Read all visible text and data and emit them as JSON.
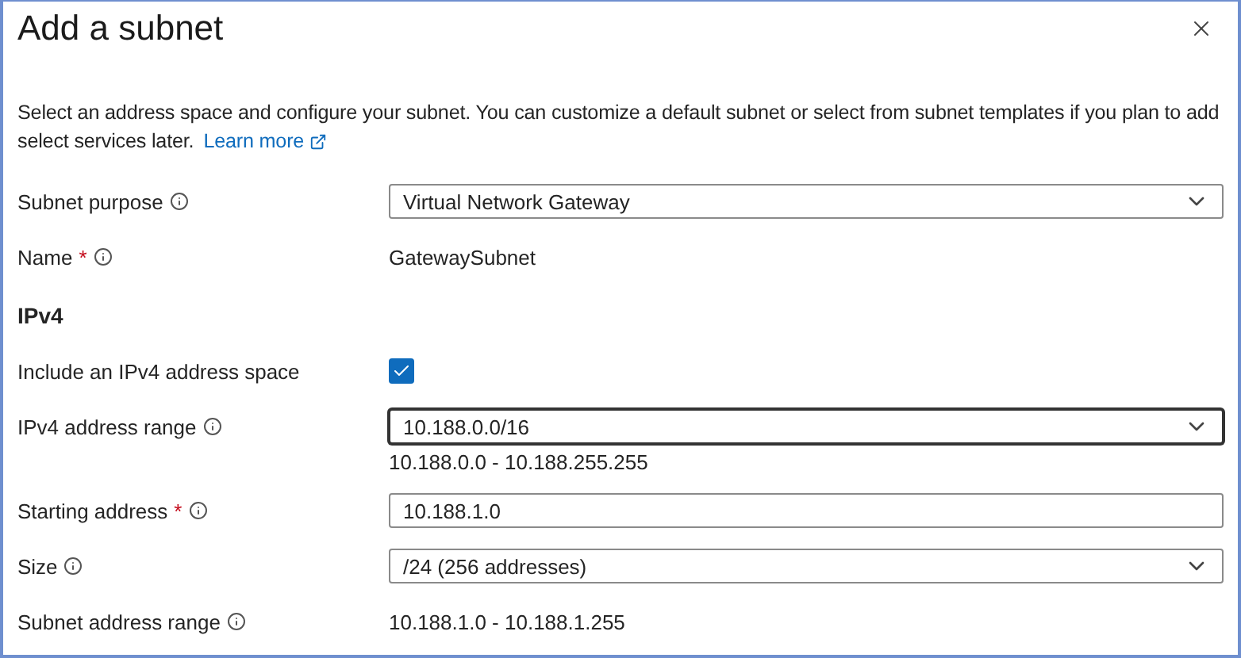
{
  "dialog": {
    "title": "Add a subnet",
    "description": "Select an address space and configure your subnet. You can customize a default subnet or select from subnet templates if you plan to add select services later.",
    "learn_more": "Learn more"
  },
  "fields": [
    {
      "kind": "dropdown",
      "label": "Subnet purpose",
      "info": true,
      "value": "Virtual Network Gateway",
      "focused": false
    },
    {
      "kind": "text",
      "label": "Name",
      "required_mark": "*",
      "info": true,
      "value": "GatewaySubnet"
    },
    {
      "kind": "heading",
      "label": "IPv4"
    },
    {
      "kind": "checkbox",
      "label": "Include an IPv4 address space",
      "info": false,
      "checked": true
    },
    {
      "kind": "dropdown",
      "label": "IPv4 address range",
      "info": true,
      "value": "10.188.0.0/16",
      "focused": true,
      "hint": "10.188.0.0 - 10.188.255.255"
    },
    {
      "kind": "input",
      "label": "Starting address",
      "required_mark": "*",
      "info": true,
      "value": "10.188.1.0"
    },
    {
      "kind": "dropdown",
      "label": "Size",
      "info": true,
      "value": "/24 (256 addresses)",
      "focused": false
    },
    {
      "kind": "text",
      "label": "Subnet address range",
      "info": true,
      "value": "10.188.1.0 - 10.188.1.255"
    }
  ]
}
